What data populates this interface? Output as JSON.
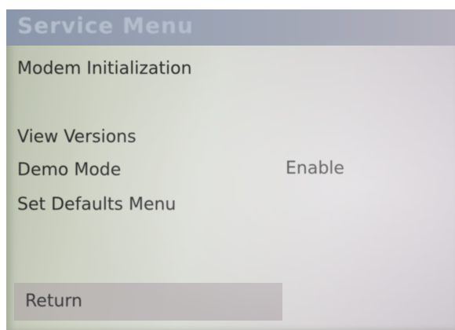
{
  "title": "Service Menu",
  "menu": {
    "modem_initialization": "Modem Initialization",
    "view_versions": "View Versions",
    "demo_mode": {
      "label": "Demo Mode",
      "value": "Enable"
    },
    "set_defaults_menu": "Set Defaults Menu",
    "return": "Return"
  },
  "colors": {
    "title_bar": "#9aa3b4",
    "title_text": "#b4bdcc",
    "screen_bg": "#d6d8d0",
    "text": "#2a2a2a",
    "selected_bar": "#aaa0a5"
  }
}
